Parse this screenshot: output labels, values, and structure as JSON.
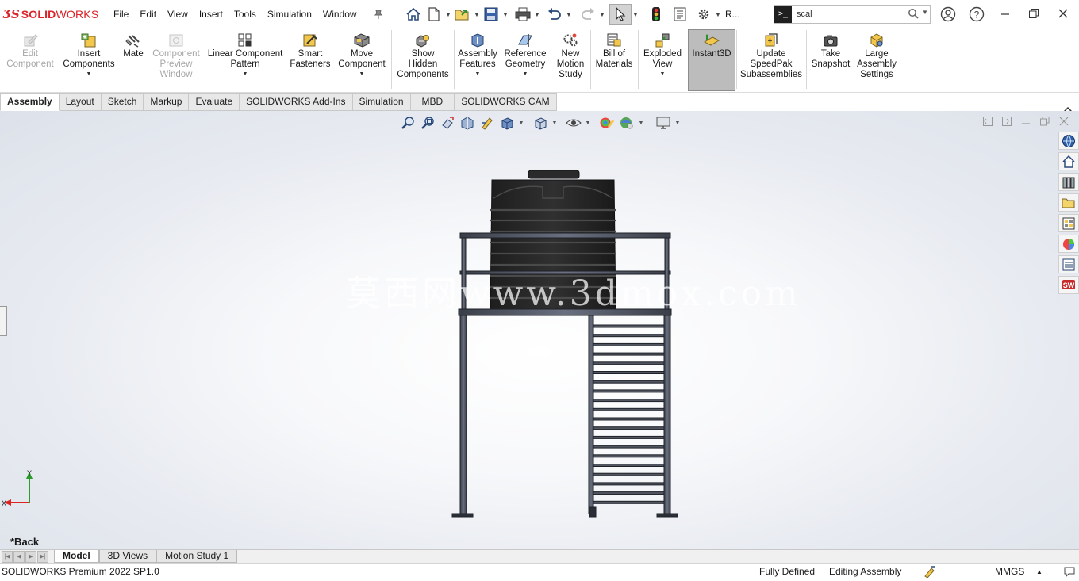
{
  "app": {
    "brand_prefix": "SOLID",
    "brand_suffix": "WORKS",
    "menu": [
      "File",
      "Edit",
      "View",
      "Insert",
      "Tools",
      "Simulation",
      "Window"
    ],
    "truncated_item": "R...",
    "search_value": "scal",
    "accent": "#d9242b"
  },
  "commands": [
    {
      "label": "Edit\nComponent",
      "icon": "edit-component-icon",
      "enabled": false,
      "dropdown": false
    },
    {
      "label": "Insert\nComponents",
      "icon": "insert-components-icon",
      "enabled": true,
      "dropdown": true
    },
    {
      "label": "Mate",
      "icon": "mate-icon",
      "enabled": true,
      "dropdown": false
    },
    {
      "label": "Component\nPreview\nWindow",
      "icon": "component-preview-icon",
      "enabled": false,
      "dropdown": false
    },
    {
      "label": "Linear Component\nPattern",
      "icon": "linear-pattern-icon",
      "enabled": true,
      "dropdown": true
    },
    {
      "label": "Smart\nFasteners",
      "icon": "smart-fasteners-icon",
      "enabled": true,
      "dropdown": false
    },
    {
      "label": "Move\nComponent",
      "icon": "move-component-icon",
      "enabled": true,
      "dropdown": true
    },
    {
      "label": "Show\nHidden\nComponents",
      "icon": "show-hidden-icon",
      "enabled": true,
      "dropdown": false
    },
    {
      "label": "Assembly\nFeatures",
      "icon": "assembly-features-icon",
      "enabled": true,
      "dropdown": true
    },
    {
      "label": "Reference\nGeometry",
      "icon": "reference-geometry-icon",
      "enabled": true,
      "dropdown": true
    },
    {
      "label": "New\nMotion\nStudy",
      "icon": "motion-study-icon",
      "enabled": true,
      "dropdown": false
    },
    {
      "label": "Bill of\nMaterials",
      "icon": "bom-icon",
      "enabled": true,
      "dropdown": false
    },
    {
      "label": "Exploded\nView",
      "icon": "exploded-view-icon",
      "enabled": true,
      "dropdown": true
    },
    {
      "label": "Instant3D",
      "icon": "instant3d-icon",
      "enabled": true,
      "dropdown": false,
      "active": true
    },
    {
      "label": "Update\nSpeedPak\nSubassemblies",
      "icon": "speedpak-icon",
      "enabled": true,
      "dropdown": false
    },
    {
      "label": "Take\nSnapshot",
      "icon": "snapshot-icon",
      "enabled": true,
      "dropdown": false
    },
    {
      "label": "Large\nAssembly\nSettings",
      "icon": "large-assembly-icon",
      "enabled": true,
      "dropdown": false
    }
  ],
  "tabs": [
    "Assembly",
    "Layout",
    "Sketch",
    "Markup",
    "Evaluate",
    "SOLIDWORKS Add-Ins",
    "Simulation",
    "MBD",
    "SOLIDWORKS CAM"
  ],
  "active_tab": "Assembly",
  "viewport": {
    "watermark": "莫西网www.3dmox.com",
    "view_label": "*Back",
    "triad_x": "X",
    "triad_y": "Y"
  },
  "bottom_tabs": [
    "Model",
    "3D Views",
    "Motion Study 1"
  ],
  "active_bottom_tab": "Model",
  "status": {
    "product": "SOLIDWORKS Premium 2022 SP1.0",
    "state": "Fully Defined",
    "mode": "Editing Assembly",
    "units": "MMGS"
  }
}
